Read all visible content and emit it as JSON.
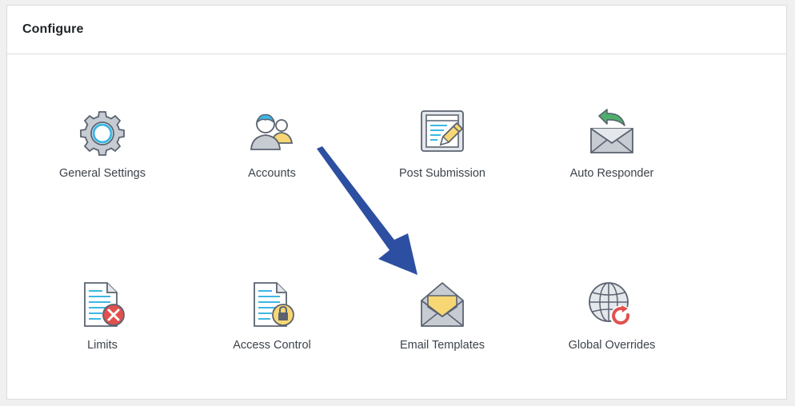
{
  "panel": {
    "title": "Configure"
  },
  "tiles": [
    {
      "label": "General Settings",
      "icon": "gear-icon"
    },
    {
      "label": "Accounts",
      "icon": "users-icon"
    },
    {
      "label": "Post Submission",
      "icon": "post-edit-icon"
    },
    {
      "label": "Auto Responder",
      "icon": "envelope-reply-icon"
    },
    {
      "label": "Limits",
      "icon": "document-x-icon"
    },
    {
      "label": "Access Control",
      "icon": "document-lock-icon"
    },
    {
      "label": "Email Templates",
      "icon": "envelope-open-icon"
    },
    {
      "label": "Global Overrides",
      "icon": "globe-refresh-icon"
    }
  ],
  "colors": {
    "icon_stroke": "#5b6370",
    "icon_gray": "#c7ccd3",
    "icon_light": "#e4e7eb",
    "accent_blue": "#3db7e4",
    "accent_yellow": "#f7d774",
    "accent_red": "#e0514e",
    "accent_green": "#4caf6a",
    "arrow_blue": "#2d4fa1"
  }
}
